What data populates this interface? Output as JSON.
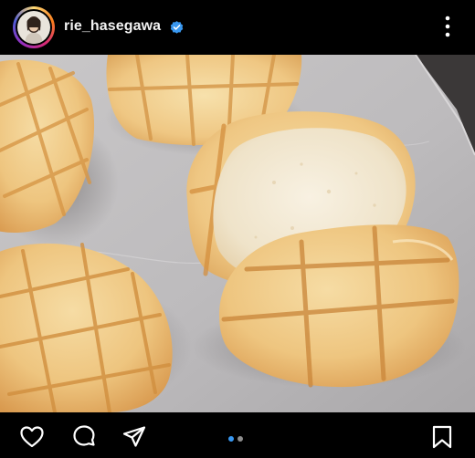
{
  "post": {
    "username": "rie_hasegawa",
    "verified": true,
    "image_subject": "melon-pan-buns-on-baking-paper"
  },
  "header": {
    "avatar_icon": "profile-avatar",
    "verified_icon": "verified-badge-icon",
    "more_icon": "more-options-icon"
  },
  "actions": [
    {
      "name": "like",
      "icon": "heart-icon"
    },
    {
      "name": "comment",
      "icon": "comment-icon"
    },
    {
      "name": "share",
      "icon": "send-icon"
    },
    {
      "name": "save",
      "icon": "bookmark-icon"
    }
  ],
  "carousel": {
    "total": 2,
    "active_index": 0,
    "active_color": "#3897f0",
    "inactive_color": "#8e8e8e"
  },
  "colors": {
    "background": "#000000",
    "text": "#ffffff",
    "verified_blue": "#3897f0",
    "ring_gradient": [
      "#feda75",
      "#fa7e1e",
      "#d62976",
      "#962fbf",
      "#4f5bd5"
    ]
  }
}
